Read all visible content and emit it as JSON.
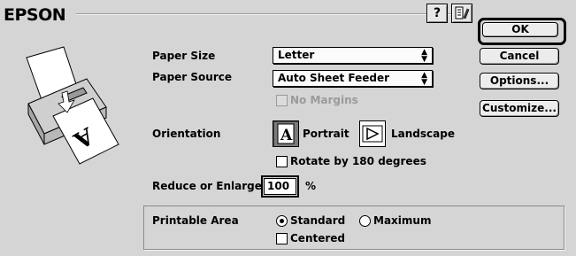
{
  "dialog": {
    "brand": "EPSON"
  },
  "buttons": {
    "ok": "OK",
    "cancel": "Cancel",
    "options": "Options...",
    "customize": "Customize..."
  },
  "paper_size": {
    "label": "Paper Size",
    "value": "Letter"
  },
  "paper_source": {
    "label": "Paper Source",
    "value": "Auto Sheet Feeder"
  },
  "no_margins": {
    "label": "No Margins",
    "checked": false,
    "enabled": false
  },
  "orientation": {
    "label": "Orientation",
    "portrait": "Portrait",
    "landscape": "Landscape",
    "selected": "Portrait"
  },
  "rotate": {
    "label": "Rotate by 180 degrees",
    "checked": false
  },
  "reduce": {
    "label": "Reduce or Enlarge",
    "value": "100",
    "unit": "%"
  },
  "printable_area": {
    "label": "Printable Area",
    "standard": "Standard",
    "maximum": "Maximum",
    "selected": "Standard",
    "centered": "Centered",
    "centered_checked": false
  },
  "icons": {
    "help": "help-icon",
    "tool": "utility-icon",
    "printer": "printer-illustration"
  }
}
